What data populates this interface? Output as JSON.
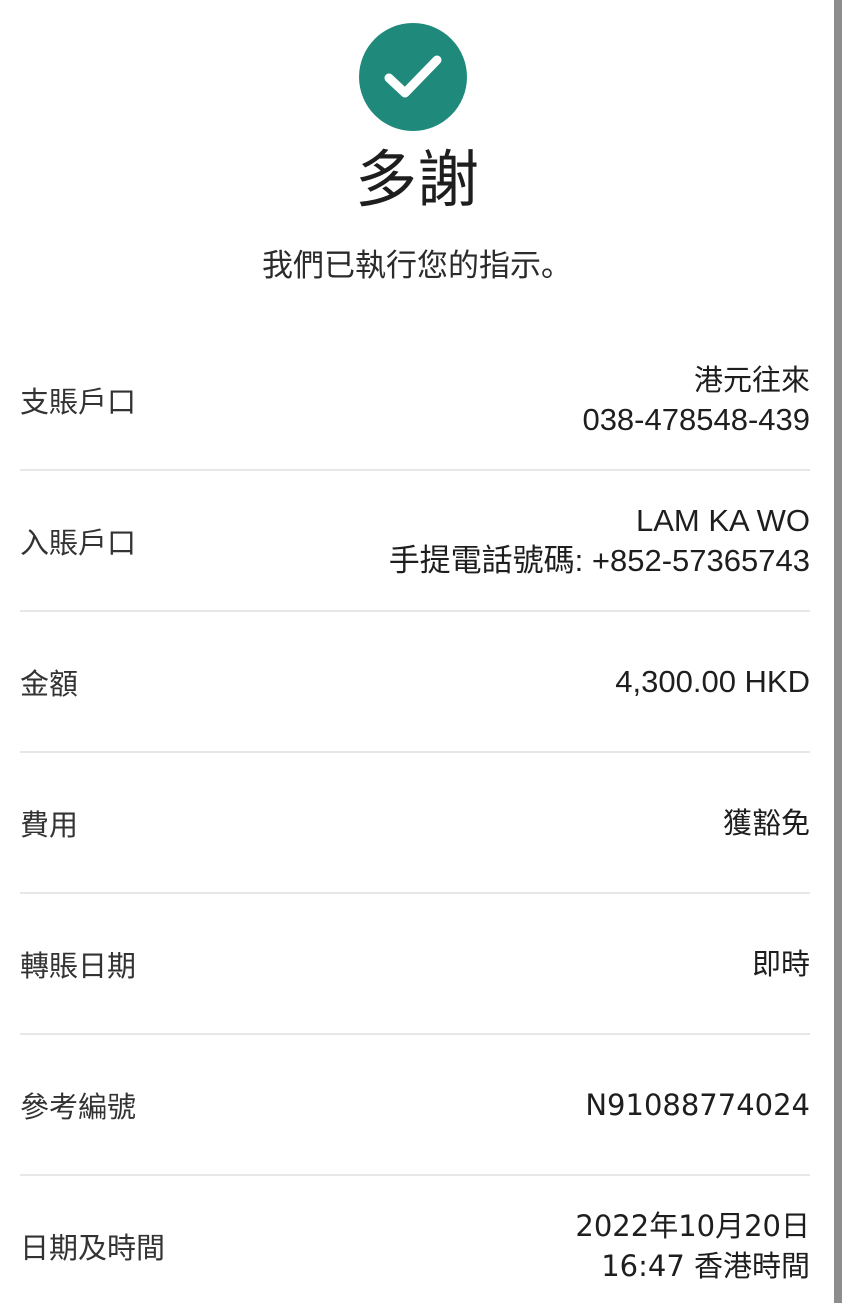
{
  "header": {
    "icon": "check-circle-icon",
    "accent_color": "#1f8a7c",
    "title": "多謝",
    "subtitle": "我們已執行您的指示。"
  },
  "details": {
    "debit_account": {
      "label": "支賬戶口",
      "type": "港元往來",
      "number": "038-478548-439"
    },
    "credit_account": {
      "label": "入賬戶口",
      "name": "LAM KA WO",
      "phone": "手提電話號碼: +852-57365743"
    },
    "amount": {
      "label": "金額",
      "value": "4,300.00 HKD"
    },
    "fee": {
      "label": "費用",
      "value": "獲豁免"
    },
    "transfer_date": {
      "label": "轉賬日期",
      "value": "即時"
    },
    "reference": {
      "label": "參考編號",
      "value": "N91088774024"
    },
    "datetime": {
      "label": "日期及時間",
      "date": "2022年10月20日",
      "time": "16:47 香港時間"
    }
  }
}
